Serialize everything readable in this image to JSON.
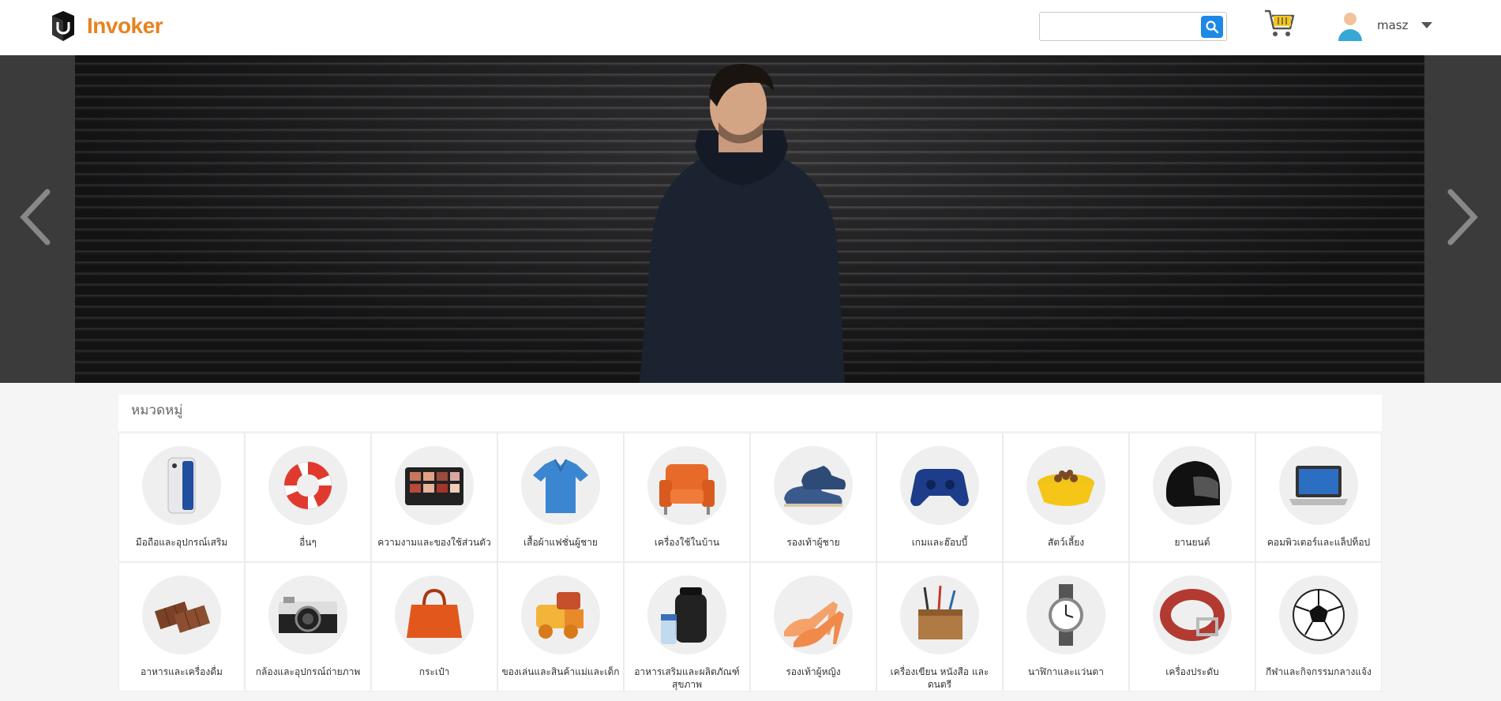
{
  "brand": {
    "name": "Invoker"
  },
  "search": {
    "placeholder": "",
    "value": ""
  },
  "user": {
    "name": "masz"
  },
  "banner": {
    "prev_icon": "chevron-left-icon",
    "next_icon": "chevron-right-icon"
  },
  "categories": {
    "title": "หมวดหมู่",
    "items": [
      {
        "label": "มือถือและอุปกรณ์เสริม",
        "icon": "smartphone"
      },
      {
        "label": "อื่นๆ",
        "icon": "lifebuoy"
      },
      {
        "label": "ความงามและของใช้ส่วนตัว",
        "icon": "makeup-palette"
      },
      {
        "label": "เสื้อผ้าแฟชั่นผู้ชาย",
        "icon": "polo-shirt"
      },
      {
        "label": "เครื่องใช้ในบ้าน",
        "icon": "armchair"
      },
      {
        "label": "รองเท้าผู้ชาย",
        "icon": "mens-shoes"
      },
      {
        "label": "เกมและฮ๊อบบี้",
        "icon": "game-controller"
      },
      {
        "label": "สัตว์เลี้ยง",
        "icon": "pet-bowl"
      },
      {
        "label": "ยานยนต์",
        "icon": "helmet"
      },
      {
        "label": "คอมพิวเตอร์และแล็ปท็อป",
        "icon": "laptop"
      },
      {
        "label": "อาหารและเครื่องดื่ม",
        "icon": "chocolate"
      },
      {
        "label": "กล้องและอุปกรณ์ถ่ายภาพ",
        "icon": "camera"
      },
      {
        "label": "กระเป๋า",
        "icon": "handbag"
      },
      {
        "label": "ของเล่นและสินค้าแม่และเด็ก",
        "icon": "toy-train"
      },
      {
        "label": "อาหารเสริมและผลิตภัณฑ์สุขภาพ",
        "icon": "supplement"
      },
      {
        "label": "รองเท้าผู้หญิง",
        "icon": "high-heels"
      },
      {
        "label": "เครื่องเขียน หนังสือ และดนตรี",
        "icon": "stationery"
      },
      {
        "label": "นาฬิกาและแว่นตา",
        "icon": "watch"
      },
      {
        "label": "เครื่องประดับ",
        "icon": "belt"
      },
      {
        "label": "กีฬาและกิจกรรมกลางแจ้ง",
        "icon": "soccer-ball"
      }
    ]
  }
}
